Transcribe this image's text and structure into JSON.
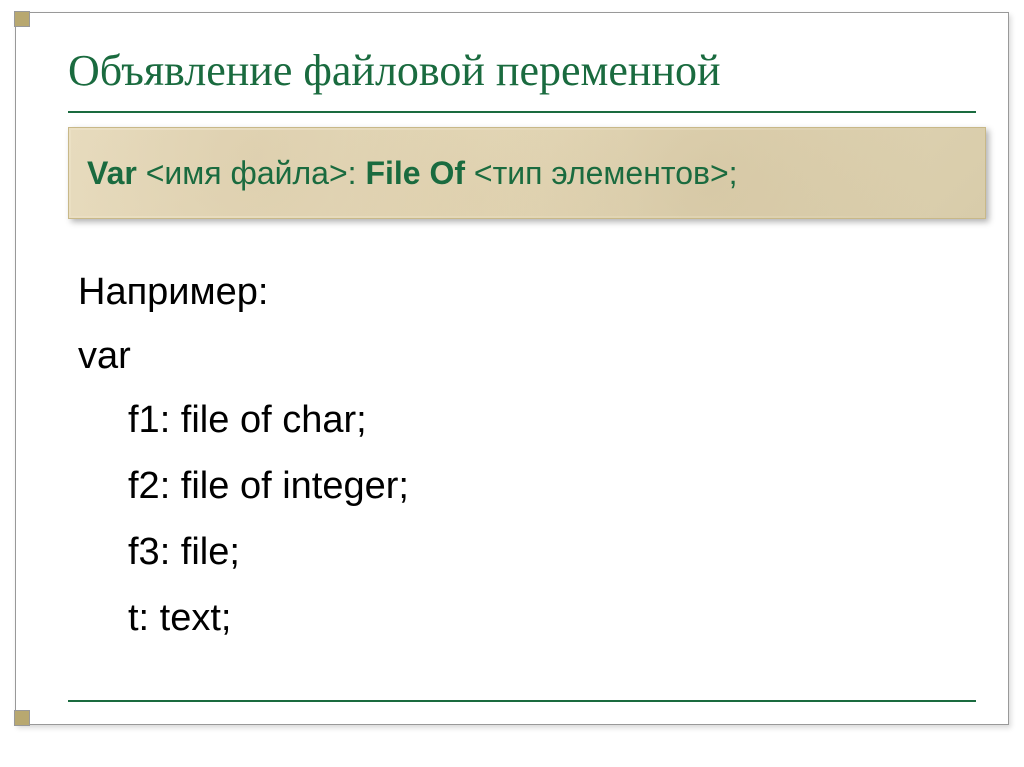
{
  "title": "Объявление файловой переменной",
  "syntax": {
    "kw_var": "Var",
    "filename_placeholder": "<имя файла>",
    "colon": ": ",
    "kw_fileof": "File Of",
    "type_placeholder": " <тип элементов>",
    "semicolon": ";"
  },
  "example_label": "Например:",
  "code": {
    "var_kw": "var",
    "lines": [
      "f1: file of char;",
      "f2: file of integer;",
      "f3: file;",
      "t: text;"
    ]
  }
}
